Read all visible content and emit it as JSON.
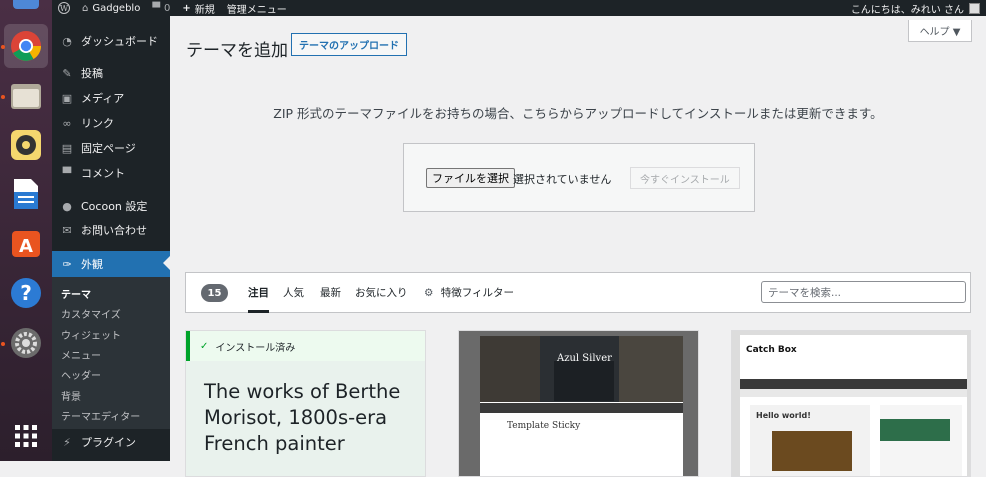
{
  "admin_bar": {
    "site_name": "Gadgeblo",
    "comments_count": "0",
    "new_label": "新規",
    "manage_menu": "管理メニュー",
    "greeting": "こんにちは、みれい さん"
  },
  "sidebar": {
    "items": [
      {
        "label": "ダッシュボード",
        "icon": "dashboard-icon"
      },
      {
        "label": "投稿",
        "icon": "pin-icon"
      },
      {
        "label": "メディア",
        "icon": "media-icon"
      },
      {
        "label": "リンク",
        "icon": "link-icon"
      },
      {
        "label": "固定ページ",
        "icon": "page-icon"
      },
      {
        "label": "コメント",
        "icon": "comment-icon"
      },
      {
        "label": "Cocoon 設定",
        "icon": "cocoon-icon"
      },
      {
        "label": "お問い合わせ",
        "icon": "mail-icon"
      },
      {
        "label": "外観",
        "icon": "appearance-icon"
      },
      {
        "label": "プラグイン",
        "icon": "plugin-icon"
      }
    ],
    "submenu": [
      "テーマ",
      "カスタマイズ",
      "ウィジェット",
      "メニュー",
      "ヘッダー",
      "背景",
      "テーマエディター"
    ]
  },
  "header": {
    "title": "テーマを追加",
    "upload_button": "テーマのアップロード",
    "help_button": "ヘルプ ▼"
  },
  "upload": {
    "description": "ZIP 形式のテーマファイルをお持ちの場合、こちらからアップロードしてインストールまたは更新できます。",
    "file_button": "ファイルを選択",
    "file_status": "選択されていません",
    "install_button": "今すぐインストール"
  },
  "filter": {
    "count": "15",
    "tabs": [
      "注目",
      "人気",
      "最新",
      "お気に入り"
    ],
    "feature_filter": "特徴フィルター",
    "search_placeholder": "テーマを検索..."
  },
  "themes": {
    "installed_label": "インストール済み",
    "card1_text": "The works of Berthe Morisot, 1800s-era French painter",
    "card2_title": "Azul Silver",
    "card2_post": "Template Sticky",
    "card3_title": "Catch Box",
    "card3_post": "Hello world!"
  },
  "colors": {
    "accent": "#2271b1",
    "installed": "#00a32a",
    "admin_dark": "#1d2327"
  }
}
